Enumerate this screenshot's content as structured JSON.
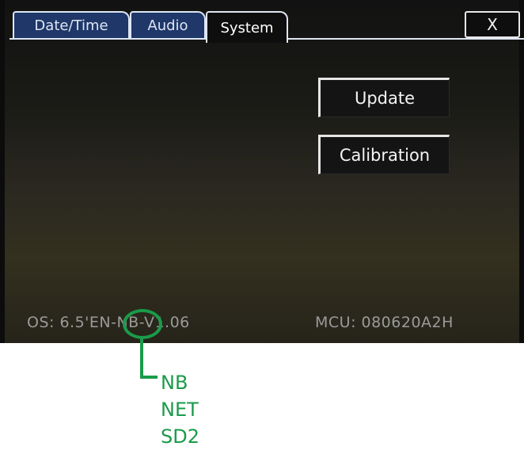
{
  "tabs": [
    {
      "label": "Date/Time"
    },
    {
      "label": "Audio"
    },
    {
      "label": "System",
      "active": true
    }
  ],
  "close_label": "X",
  "buttons": {
    "update": "Update",
    "calibration": "Calibration"
  },
  "status": {
    "os": "OS: 6.5'EN-NB-V1.06",
    "mcu": "MCU: 080620A2H"
  },
  "annotation": {
    "options": [
      "NB",
      "NET",
      "SD2"
    ],
    "color": "#1a9b4a"
  }
}
